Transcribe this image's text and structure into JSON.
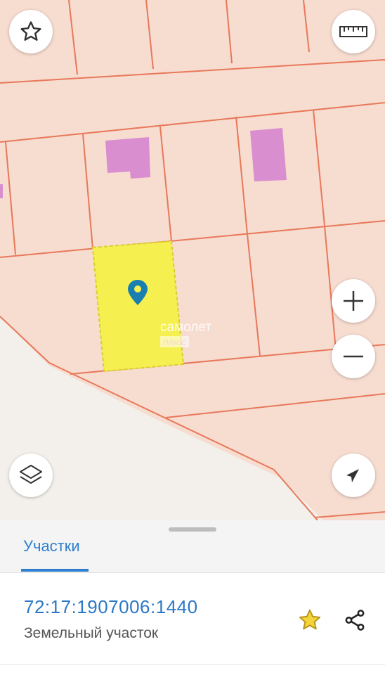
{
  "map": {
    "watermark": "самолет",
    "watermark_sub": "плюс",
    "colors": {
      "background": "#f7dcd0",
      "parcel_line": "#e8785a",
      "selected_fill": "#f5f050",
      "building_fill": "#d98fcf",
      "pin": "#1a7fb0",
      "road": "#f3efea"
    },
    "controls": {
      "favorite_icon": "star-outline-icon",
      "ruler_icon": "ruler-icon",
      "zoom_in_icon": "plus-icon",
      "zoom_out_icon": "minus-icon",
      "layers_icon": "layers-icon",
      "locate_icon": "navigation-arrow-icon"
    }
  },
  "sheet": {
    "tab_label": "Участки",
    "parcel": {
      "number": "72:17:1907006:1440",
      "type": "Земельный участок"
    },
    "actions": {
      "favorite_icon": "star-icon",
      "share_icon": "share-icon",
      "favorite_color": "#e8c21a"
    }
  }
}
